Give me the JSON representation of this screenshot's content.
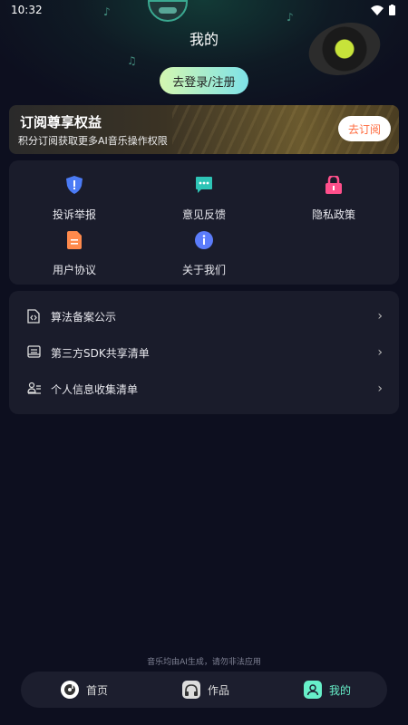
{
  "status_bar": {
    "time": "10:32"
  },
  "header": {
    "title": "我的"
  },
  "login": {
    "label": "去登录/注册"
  },
  "vip_banner": {
    "title": "订阅尊享权益",
    "subtitle": "积分订阅获取更多AI音乐操作权限",
    "button": "去订阅"
  },
  "grid": [
    {
      "label": "投诉举报",
      "icon": "shield-alert-icon",
      "color": "#4b7bf5"
    },
    {
      "label": "意见反馈",
      "icon": "chat-bubble-icon",
      "color": "#2ec4b6"
    },
    {
      "label": "隐私政策",
      "icon": "lock-icon",
      "color": "#ff4f8b"
    },
    {
      "label": "用户协议",
      "icon": "document-icon",
      "color": "#ff8a4c"
    },
    {
      "label": "关于我们",
      "icon": "info-icon",
      "color": "#5b7cfa"
    }
  ],
  "list": [
    {
      "label": "算法备案公示",
      "icon": "code-file-icon"
    },
    {
      "label": "第三方SDK共享清单",
      "icon": "inbox-tray-icon"
    },
    {
      "label": "个人信息收集清单",
      "icon": "id-card-icon"
    }
  ],
  "footnote": "音乐均由AI生成，请勿非法应用",
  "tabs": [
    {
      "label": "首页",
      "icon": "music-disc-icon",
      "active": false
    },
    {
      "label": "作品",
      "icon": "headphones-icon",
      "active": false
    },
    {
      "label": "我的",
      "icon": "user-icon",
      "active": true
    }
  ],
  "colors": {
    "accent": "#67f0c9",
    "background": "#0d0f1f",
    "card": "#1a1c2b",
    "vip_button_text": "#ff6a3d"
  }
}
